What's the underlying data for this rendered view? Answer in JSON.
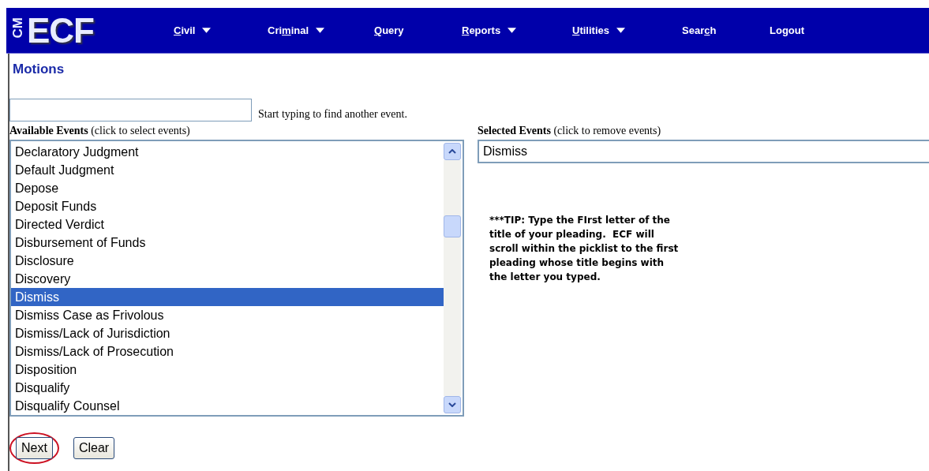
{
  "logo": {
    "small": "CM",
    "big": "ECF"
  },
  "menu": [
    {
      "key": "C",
      "post": "ivil",
      "dropdown": true
    },
    {
      "pre": "Cri",
      "key": "m",
      "post": "inal",
      "dropdown": true
    },
    {
      "key": "Q",
      "post": "uery",
      "dropdown": false
    },
    {
      "key": "R",
      "post": "eports",
      "dropdown": true
    },
    {
      "key": "U",
      "post": "tilities",
      "dropdown": true
    },
    {
      "pre": "Sear",
      "key": "c",
      "post": "h",
      "dropdown": false
    },
    {
      "pre": "Logout",
      "dropdown": false
    }
  ],
  "page_title": "Motions",
  "find": {
    "hint": "Start typing to find another event."
  },
  "available": {
    "label": "Available Events",
    "note": "(click to select events)",
    "items": [
      {
        "text": "Declaratory Judgment",
        "selected": false
      },
      {
        "text": "Default Judgment",
        "selected": false
      },
      {
        "text": "Depose",
        "selected": false
      },
      {
        "text": "Deposit Funds",
        "selected": false
      },
      {
        "text": "Directed Verdict",
        "selected": false
      },
      {
        "text": "Disbursement of Funds",
        "selected": false
      },
      {
        "text": "Disclosure",
        "selected": false
      },
      {
        "text": "Discovery",
        "selected": false
      },
      {
        "text": "Dismiss",
        "selected": true
      },
      {
        "text": "Dismiss Case as Frivolous",
        "selected": false
      },
      {
        "text": "Dismiss/Lack of Jurisdiction",
        "selected": false
      },
      {
        "text": "Dismiss/Lack of Prosecution",
        "selected": false
      },
      {
        "text": "Disposition",
        "selected": false
      },
      {
        "text": "Disqualify",
        "selected": false
      },
      {
        "text": "Disqualify Counsel",
        "selected": false
      }
    ]
  },
  "selected_events": {
    "label": "Selected Events",
    "note": "(click to remove events)",
    "items": [
      "Dismiss"
    ]
  },
  "tip": "***TIP: Type the FIrst letter of the title of your pleading.  ECF will scroll within the picklist to the first pleading whose title begins with the letter you typed.",
  "buttons": [
    {
      "label": "Next",
      "circled": true
    },
    {
      "label": "Clear",
      "circled": false
    }
  ]
}
